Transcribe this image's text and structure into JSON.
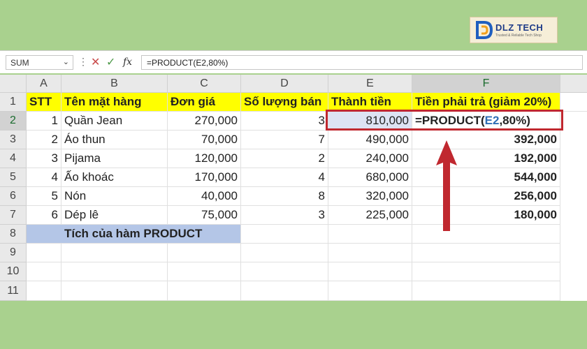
{
  "logo": {
    "brand": "DLZ TECH",
    "tagline": "Trusted & Reliable Tech Shop"
  },
  "formula_bar": {
    "name_box": "SUM",
    "name_box_caret": "⌄",
    "more_icon": "⋮",
    "cancel_icon": "✕",
    "enter_icon": "✓",
    "fx_label": "fx",
    "formula": "=PRODUCT(E2,80%)"
  },
  "columns": [
    "A",
    "B",
    "C",
    "D",
    "E",
    "F"
  ],
  "rows": [
    "1",
    "2",
    "3",
    "4",
    "5",
    "6",
    "7",
    "8",
    "9",
    "10",
    "11"
  ],
  "headers": {
    "stt": "STT",
    "name": "Tên mặt hàng",
    "price": "Đơn giá",
    "qty": "Số lượng bán",
    "total": "Thành tiền",
    "pay": "Tiền phải trả (giảm 20%)"
  },
  "data_rows": [
    {
      "stt": "1",
      "name": "Quần Jean",
      "price": "270,000",
      "qty": "3",
      "total": "810,000",
      "pay": ""
    },
    {
      "stt": "2",
      "name": "Áo thun",
      "price": "70,000",
      "qty": "7",
      "total": "490,000",
      "pay": "392,000"
    },
    {
      "stt": "3",
      "name": "Pijama",
      "price": "120,000",
      "qty": "2",
      "total": "240,000",
      "pay": "192,000"
    },
    {
      "stt": "4",
      "name": "Ấo khoác",
      "price": "170,000",
      "qty": "4",
      "total": "680,000",
      "pay": "544,000"
    },
    {
      "stt": "5",
      "name": "Nón",
      "price": "40,000",
      "qty": "8",
      "total": "320,000",
      "pay": "256,000"
    },
    {
      "stt": "6",
      "name": "Dép lê",
      "price": "75,000",
      "qty": "3",
      "total": "225,000",
      "pay": "180,000"
    }
  ],
  "editing_cell": {
    "prefix": "=PRODUCT(",
    "ref": "E2",
    "suffix": ",80%)"
  },
  "caption": "Tích của hàm PRODUCT",
  "colors": {
    "header_fill": "#ffff00",
    "caption_fill": "#b4c6e7",
    "highlight": "#c0282f",
    "ref_blue": "#2f6eb5",
    "background": "#a9d18e"
  }
}
